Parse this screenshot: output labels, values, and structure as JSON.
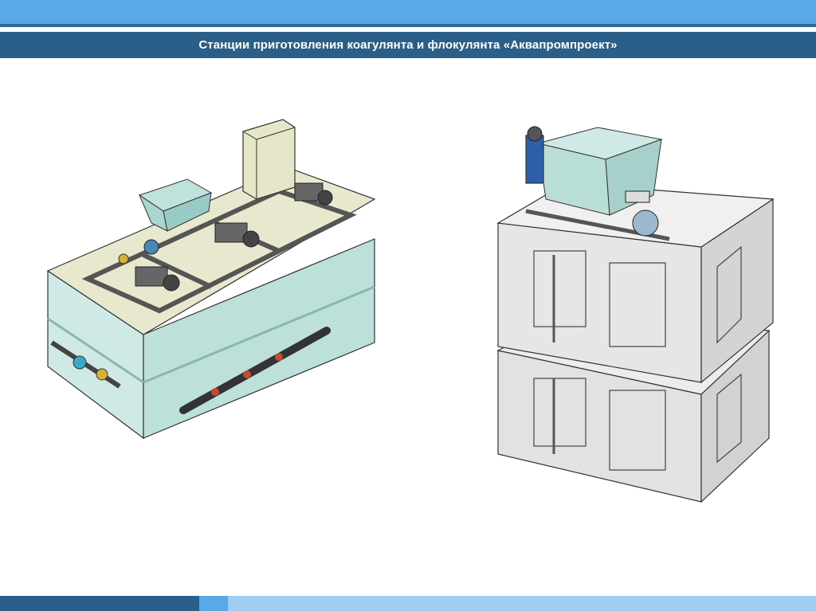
{
  "header": {
    "title": "Станции приготовления коагулянта и флокулянта «Аквапромпроект»",
    "accent_color": "#2a5f8a",
    "light_color": "#5aa9e6"
  },
  "illustrations": {
    "left": "coagulant-dosing-station-render",
    "right": "flocculant-dosing-station-render"
  }
}
